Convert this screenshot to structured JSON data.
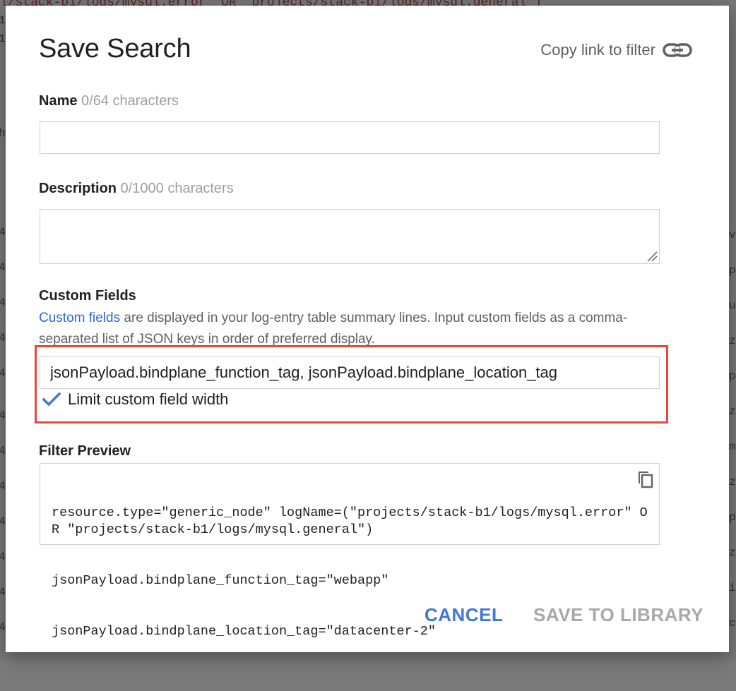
{
  "dialog": {
    "title": "Save Search",
    "copy_link_label": "Copy link to filter"
  },
  "name_field": {
    "label": "Name",
    "hint": "0/64 characters",
    "value": ""
  },
  "description_field": {
    "label": "Description",
    "hint": "0/1000 characters",
    "value": ""
  },
  "custom_fields": {
    "label": "Custom Fields",
    "link_text": "Custom fields",
    "description": " are displayed in your log-entry table summary lines. Input custom fields as a comma-separated list of JSON keys in order of preferred display.",
    "value": "jsonPayload.bindplane_function_tag, jsonPayload.bindplane_location_tag",
    "limit_width_label": "Limit custom field width",
    "limit_width_checked": true
  },
  "filter_preview": {
    "label": "Filter Preview",
    "lines": [
      "resource.type=\"generic_node\" logName=(\"projects/stack-b1/logs/mysql.error\" OR \"projects/stack-b1/logs/mysql.general\")",
      "jsonPayload.bindplane_function_tag=\"webapp\"",
      "jsonPayload.bindplane_location_tag=\"datacenter-2\""
    ]
  },
  "actions": {
    "cancel": "CANCEL",
    "save": "SAVE TO LIBRARY"
  },
  "colors": {
    "accent": "#3f78d6",
    "highlight_border": "#e34a3c",
    "disabled_text": "#a8a8a8"
  }
}
